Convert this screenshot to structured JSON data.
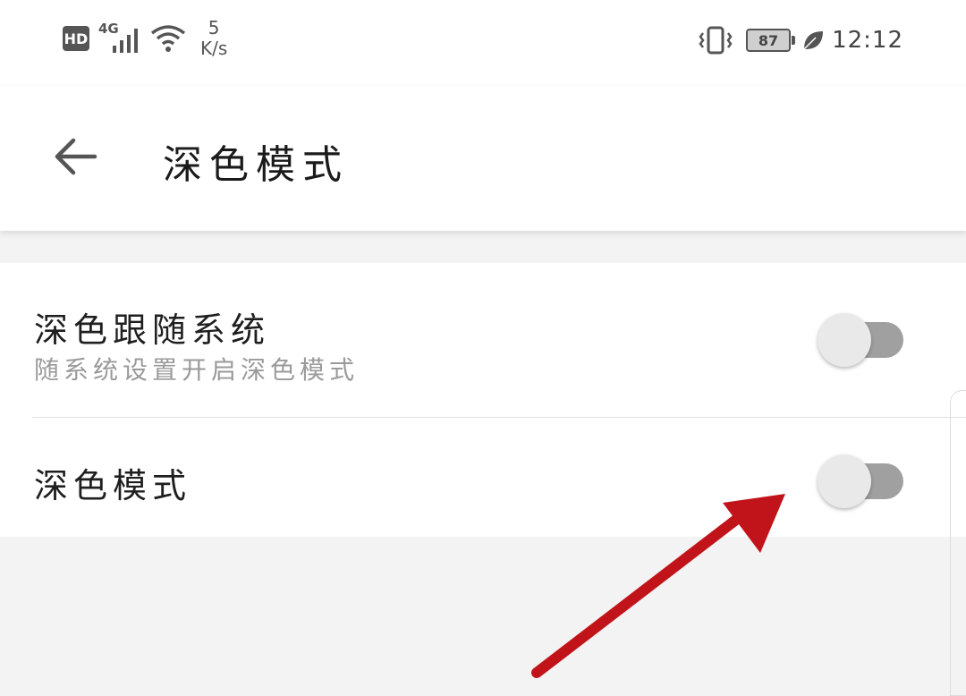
{
  "status_bar": {
    "hd": "HD",
    "network": "4G",
    "speed_value": "5",
    "speed_unit": "K/s",
    "battery": "87",
    "time": "12:12",
    "icons": [
      "signal-icon",
      "wifi-icon",
      "vibrate-icon",
      "battery-icon",
      "leaf-icon"
    ]
  },
  "app_bar": {
    "back_icon": "arrow-left-icon",
    "title": "深色模式"
  },
  "settings": {
    "follow_system": {
      "title": "深色跟随系统",
      "subtitle": "随系统设置开启深色模式",
      "enabled": false
    },
    "dark_mode": {
      "title": "深色模式",
      "enabled": false
    }
  },
  "colors": {
    "annotation_arrow": "#c0141a",
    "toggle_track_off": "#a0a0a0",
    "toggle_thumb": "#e9e9e9",
    "background": "#f3f3f3"
  }
}
